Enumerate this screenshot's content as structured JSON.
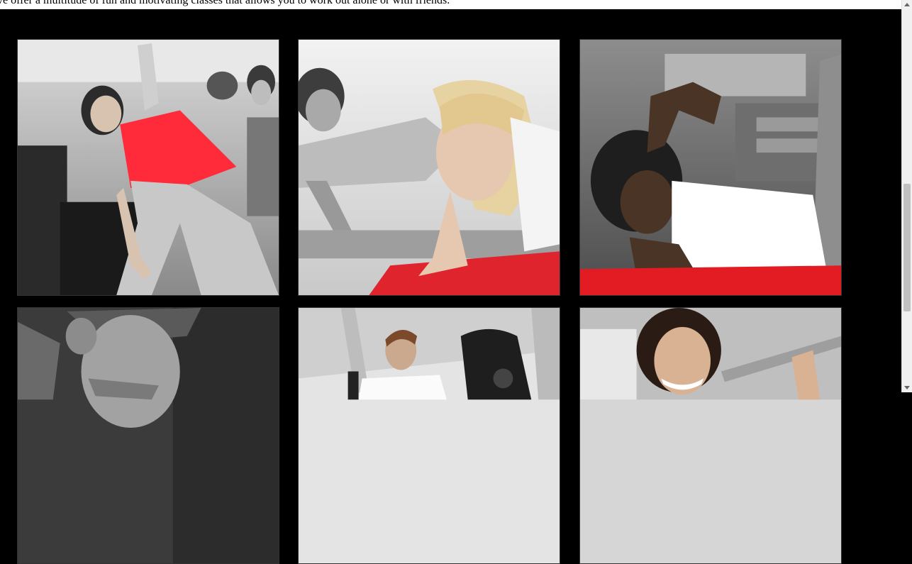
{
  "intro": {
    "text": "ve offer a multitude of fun and motivating classes that allows you to work out alone or with friends."
  },
  "gallery": {
    "tiles": [
      {
        "name": "stretching-class-photo",
        "accent": "#ff2b3a"
      },
      {
        "name": "pushup-woman-photo",
        "accent": "#e0242e"
      },
      {
        "name": "situp-woman-photo",
        "accent": "#e31b22"
      },
      {
        "name": "man-portrait-photo",
        "accent": "#888888"
      },
      {
        "name": "man-treadmill-photo",
        "accent": "#999999"
      },
      {
        "name": "woman-barbell-photo",
        "accent": "#aaaaaa"
      }
    ]
  },
  "colors": {
    "background": "#000000",
    "accent_red": "#ff2b3a"
  }
}
